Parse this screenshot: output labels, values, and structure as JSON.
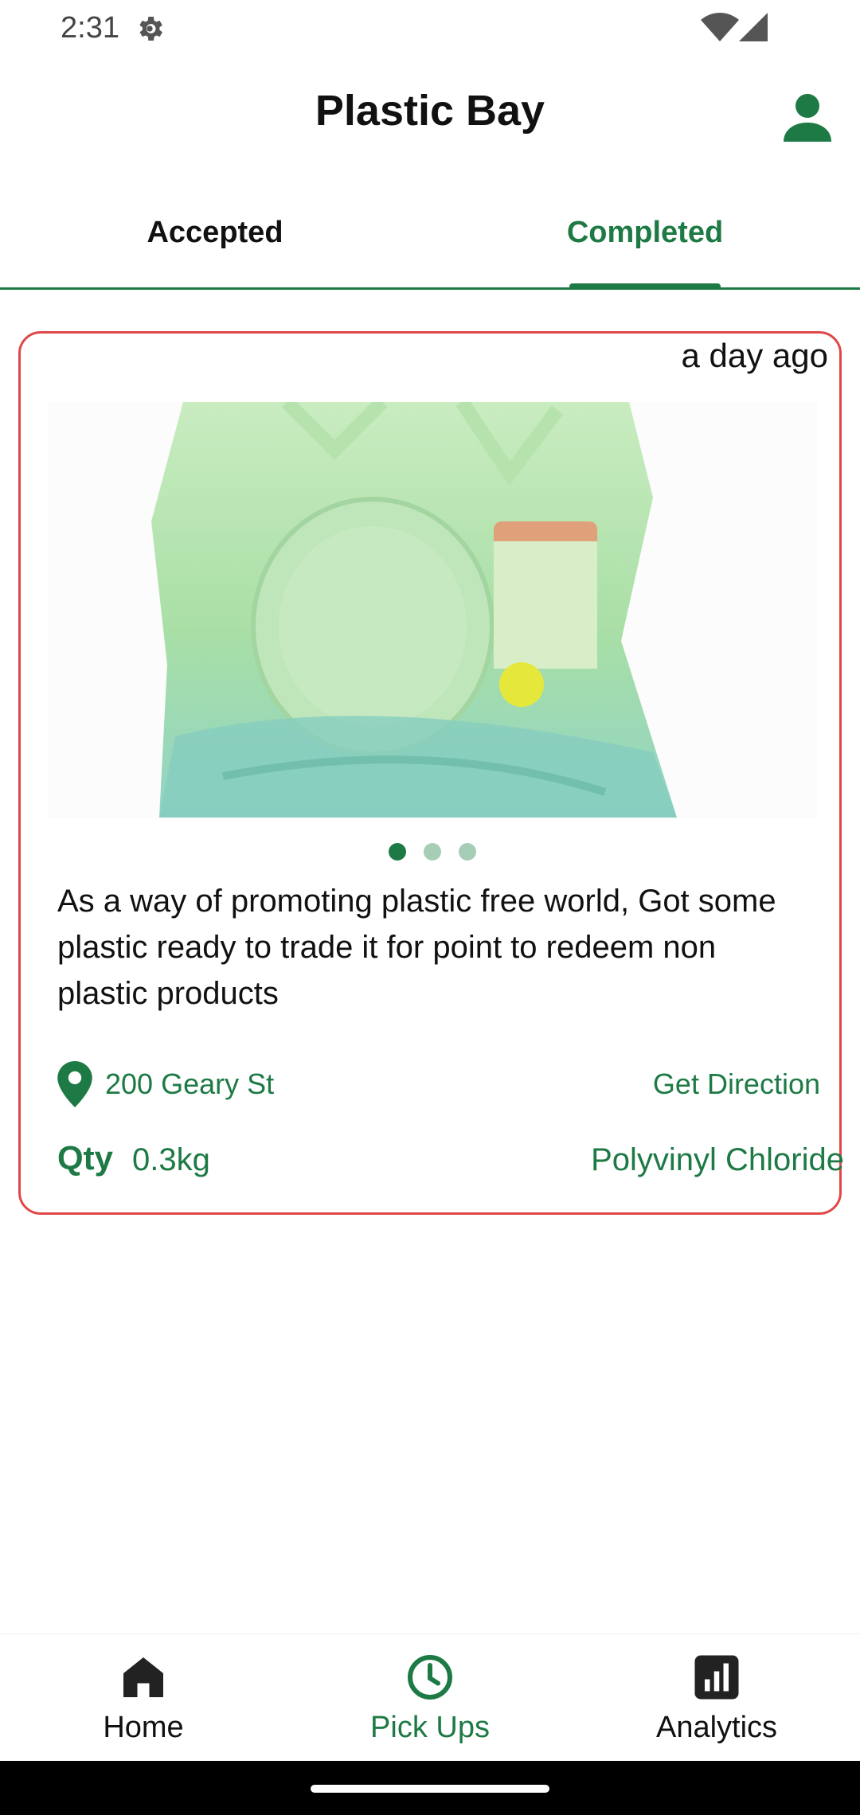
{
  "status_bar": {
    "time": "2:31",
    "icons": [
      "gear-icon",
      "wifi-icon",
      "signal-icon"
    ]
  },
  "app_bar": {
    "title": "Plastic Bay",
    "profile_icon": "person-icon"
  },
  "tabs": [
    {
      "label": "Accepted",
      "selected": false
    },
    {
      "label": "Completed",
      "selected": true
    }
  ],
  "pickup_card": {
    "time_ago": "a day ago",
    "image": "plastic-bag-photo",
    "carousel_pages": 3,
    "carousel_active_index": 0,
    "description": "As a way of promoting plastic free world, Got some plastic ready to trade it for point to redeem non plastic products",
    "address": "200 Geary St",
    "direction_label": "Get Direction",
    "qty_label": "Qty",
    "qty_value": "0.3kg",
    "plastic_type": "Polyvinyl Chloride"
  },
  "bottom_nav": [
    {
      "label": "Home",
      "icon": "home-icon",
      "selected": false
    },
    {
      "label": "Pick Ups",
      "icon": "clock-icon",
      "selected": true
    },
    {
      "label": "Analytics",
      "icon": "bar-chart-icon",
      "selected": false
    }
  ],
  "colors": {
    "primary_green": "#1e7a45",
    "card_border": "#e04848",
    "dot_inactive": "#a6cdb5"
  }
}
